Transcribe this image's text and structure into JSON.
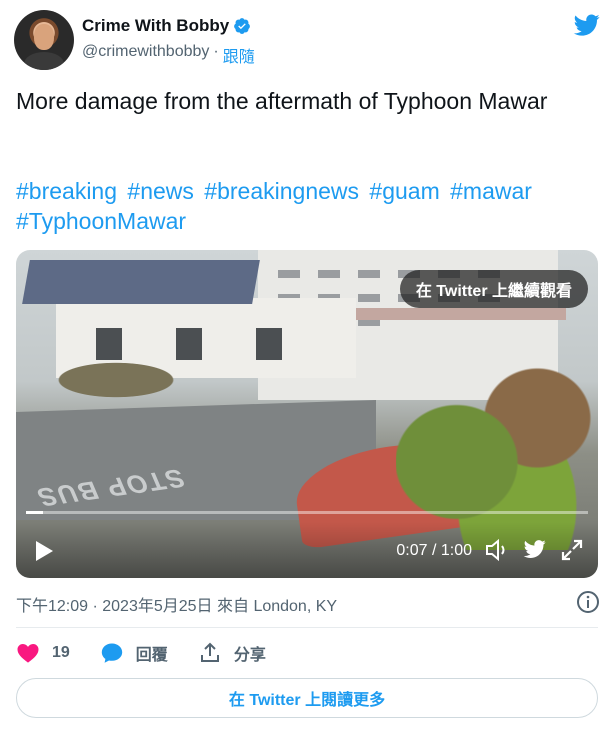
{
  "author": {
    "name": "Crime With Bobby",
    "handle": "@crimewithbobby",
    "separator": "·",
    "follow_label": "跟隨"
  },
  "tweet": {
    "text": "More damage from the aftermath of Typhoon Mawar",
    "hashtags": [
      "#breaking",
      "#news",
      "#breakingnews",
      "#guam",
      "#mawar",
      "#TyphoonMawar"
    ]
  },
  "video": {
    "watch_on_twitter_label": "在 Twitter 上繼續觀看",
    "time": "0:07 / 1:00",
    "progress": 0.03,
    "road_text": "STOP BUS"
  },
  "meta": {
    "timestamp": "下午12:09 · 2023年5月25日 來自 London, KY"
  },
  "actions": {
    "like_count": "19",
    "reply_label": "回覆",
    "share_label": "分享"
  },
  "read_more_label": "在 Twitter 上閱讀更多",
  "colors": {
    "accent": "#1d9bf0",
    "like": "#f91880",
    "text": "#0f1419",
    "muted": "#536471"
  },
  "icons": [
    "verified-badge-icon",
    "twitter-bird-icon",
    "play-icon",
    "volume-icon",
    "expand-icon",
    "info-icon",
    "heart-icon",
    "reply-bubble-icon",
    "share-icon"
  ]
}
